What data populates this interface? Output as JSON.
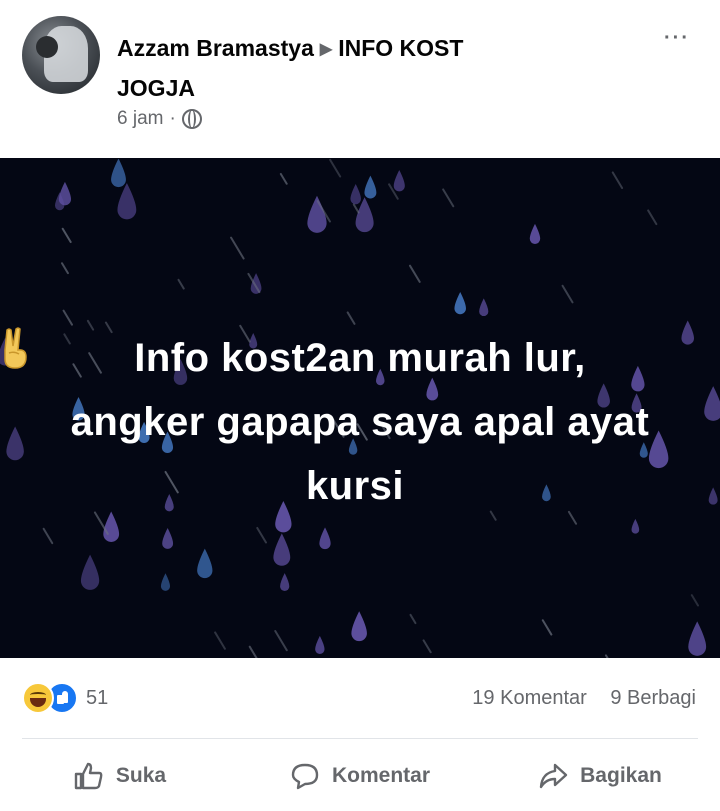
{
  "post": {
    "author": "Azzam Bramastya",
    "group": "INFO KOST",
    "group_line2": "JOGJA",
    "time": "6 jam",
    "meta_separator": "·",
    "privacy_icon": "globe-icon",
    "more_icon": "more-options-icon",
    "more_glyph": "···"
  },
  "image": {
    "background": "#040714",
    "drop_color": "#5d4f9e",
    "text_lines": [
      "Info kost2an murah lur,",
      "angker gapapa saya apal ayat",
      "kursi"
    ],
    "emoji": "victory-hand-emoji"
  },
  "stats": {
    "reaction_icons": [
      "haha-reaction-icon",
      "like-reaction-icon"
    ],
    "reaction_count": "51",
    "comments": "19 Komentar",
    "shares": "9 Berbagi"
  },
  "actions": [
    {
      "label": "Suka",
      "icon": "like-icon"
    },
    {
      "label": "Komentar",
      "icon": "comment-icon"
    },
    {
      "label": "Bagikan",
      "icon": "share-icon"
    }
  ],
  "colors": {
    "secondary_text": "#65676b",
    "like_blue": "#1877f2",
    "haha_yellow": "#f7c83a"
  }
}
